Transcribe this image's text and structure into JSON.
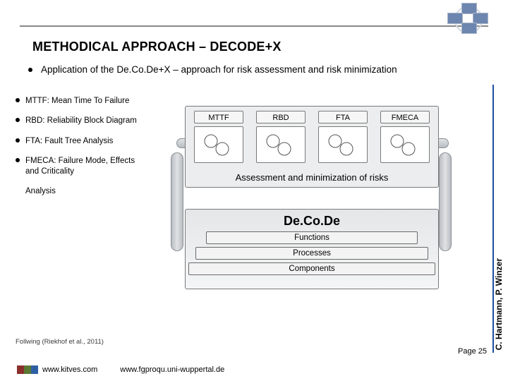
{
  "header": {
    "title": "METHODICAL APPROACH – DECODE+X"
  },
  "lead": "Application of the De.Co.De+X – approach for risk assessment and risk minimization",
  "definitions": [
    "MTTF: Mean Time To Failure",
    "RBD: Reliability Block Diagram",
    "FTA: Fault Tree Analysis",
    "FMECA: Failure Mode, Effects and Criticality"
  ],
  "orphan_line": "Analysis",
  "diagram": {
    "methods": [
      "MTTF",
      "RBD",
      "FTA",
      "FMECA"
    ],
    "assessment_label": "Assessment and minimization of risks",
    "decode_label": "De.Co.De",
    "layers": {
      "functions": "Functions",
      "processes": "Processes",
      "components": "Components"
    }
  },
  "citation": "Follwing (Riekhof et al., 2011)",
  "side_authors": "C. Hartmann, P. Winzer",
  "footer": {
    "kitves_url": "www.kitves.com",
    "fgproqu_url": "www.fgproqu.uni-wuppertal.de",
    "page": "Page 25"
  }
}
